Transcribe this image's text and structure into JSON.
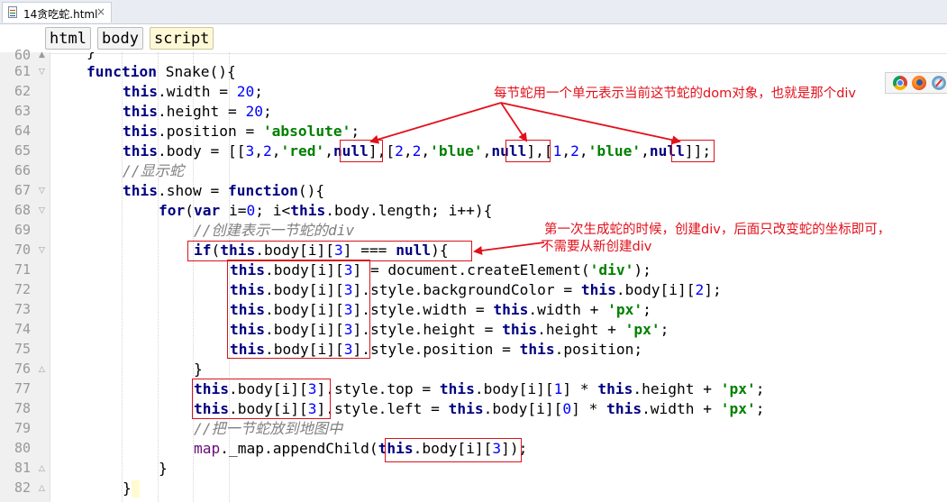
{
  "tab": {
    "filename": "14贪吃蛇.html",
    "close": "×"
  },
  "breadcrumbs": [
    "html",
    "body",
    "script"
  ],
  "line_numbers": [
    "60",
    "61",
    "62",
    "63",
    "64",
    "65",
    "66",
    "67",
    "68",
    "69",
    "70",
    "71",
    "72",
    "73",
    "74",
    "75",
    "76",
    "77",
    "78",
    "79",
    "80",
    "81",
    "82"
  ],
  "code": {
    "l60": "}",
    "l61": "function Snake(){",
    "l62": "this.width = 20;",
    "l63": "this.height = 20;",
    "l64": "this.position = 'absolute';",
    "l65": "this.body = [[3,2,'red',null],[2,2,'blue',null],[1,2,'blue',null]];",
    "l66": "//显示蛇",
    "l67": "this.show = function(){",
    "l68": "for(var i=0; i<this.body.length; i++){",
    "l69": "//创建表示一节蛇的div",
    "l70": "if(this.body[i][3] === null){",
    "l71": "this.body[i][3] = document.createElement('div');",
    "l72": "this.body[i][3].style.backgroundColor = this.body[i][2];",
    "l73": "this.body[i][3].style.width = this.width + 'px';",
    "l74": "this.body[i][3].style.height = this.height + 'px';",
    "l75": "this.body[i][3].style.position = this.position;",
    "l76": "}",
    "l77": "this.body[i][3].style.top = this.body[i][1] * this.height + 'px';",
    "l78": "this.body[i][3].style.left = this.body[i][0] * this.width + 'px';",
    "l79": "//把一节蛇放到地图中",
    "l80": "map._map.appendChild(this.body[i][3]);",
    "l81": "}",
    "l82": "}"
  },
  "annotations": {
    "note1": "每节蛇用一个单元表示当前这节蛇的dom对象，也就是那个div",
    "note2_line1": "第一次生成蛇的时候，创建div，后面只改变蛇的坐标即可，",
    "note2_line2": "不需要从新创建div"
  },
  "browser_icons": [
    "chrome-icon",
    "firefox-icon",
    "safari-icon"
  ],
  "colors": {
    "annotation_red": "#e3101b",
    "keyword_navy": "#000080",
    "number_blue": "#0000ff",
    "string_green": "#008000",
    "comment_gray": "#808080"
  }
}
